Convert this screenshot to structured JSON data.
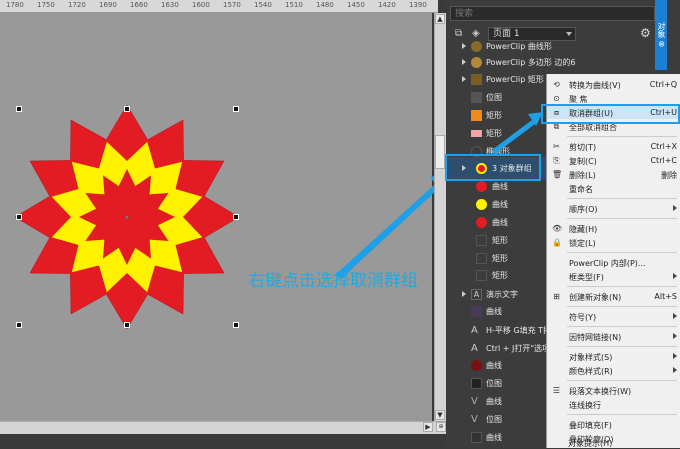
{
  "ruler": {
    "ticks": [
      "1780",
      "1750",
      "1720",
      "1690",
      "1660",
      "1630",
      "1600",
      "1570",
      "1540",
      "1510",
      "1480",
      "1450",
      "1420",
      "1390"
    ]
  },
  "annotation": {
    "text": "右键点击选择取消群组"
  },
  "colors": {
    "accent": "#21a9e1",
    "star_red": "#e31b23",
    "star_yellow": "#fff200"
  },
  "panel": {
    "search_placeholder": "搜索",
    "page_label": "页面 1",
    "docker_tab": "对象 ⊗",
    "objects": [
      {
        "label": "PowerClip 曲线形"
      },
      {
        "label": "PowerClip 多边形 边的6"
      },
      {
        "label": "PowerClip 矩形"
      },
      {
        "label": "位图"
      },
      {
        "label": "矩形"
      },
      {
        "label": "矩形"
      },
      {
        "label": "椭圆形"
      },
      {
        "label": "3 对象群组"
      },
      {
        "label": "曲线"
      },
      {
        "label": "曲线"
      },
      {
        "label": "曲线"
      },
      {
        "label": "矩形"
      },
      {
        "label": "矩形"
      },
      {
        "label": "矩形"
      },
      {
        "label": "演示文字"
      },
      {
        "label": "曲线"
      },
      {
        "label": "H-平移  G填充 T拷贝"
      },
      {
        "label": "Ctrl + J打开\"选项\""
      },
      {
        "label": "曲线"
      },
      {
        "label": "位图"
      },
      {
        "label": "曲线"
      },
      {
        "label": "位图"
      },
      {
        "label": "曲线"
      }
    ]
  },
  "menu": {
    "items": [
      {
        "label": "转换为曲线(V)",
        "shortcut": "Ctrl+Q"
      },
      {
        "label": "聚 焦",
        "shortcut": ""
      },
      {
        "label": "取消群组(U)",
        "shortcut": "Ctrl+U"
      },
      {
        "label": "全部取消组合",
        "shortcut": ""
      },
      {
        "label": "剪切(T)",
        "shortcut": "Ctrl+X"
      },
      {
        "label": "复制(C)",
        "shortcut": "Ctrl+C"
      },
      {
        "label": "删除(L)",
        "shortcut": "删除"
      },
      {
        "label": "重命名",
        "shortcut": ""
      },
      {
        "label": "顺序(O)",
        "shortcut": ""
      },
      {
        "label": "隐藏(H)",
        "shortcut": ""
      },
      {
        "label": "锁定(L)",
        "shortcut": ""
      },
      {
        "label": "PowerClip 内部(P)...",
        "shortcut": ""
      },
      {
        "label": "框类型(F)",
        "shortcut": ""
      },
      {
        "label": "创建新对象(N)",
        "shortcut": "Alt+S"
      },
      {
        "label": "符号(Y)",
        "shortcut": ""
      },
      {
        "label": "因特网链接(N)",
        "shortcut": ""
      },
      {
        "label": "对象样式(S)",
        "shortcut": ""
      },
      {
        "label": "颜色样式(R)",
        "shortcut": ""
      },
      {
        "label": "段落文本换行(W)",
        "shortcut": ""
      },
      {
        "label": "连线换行",
        "shortcut": ""
      },
      {
        "label": "叠印填充(F)",
        "shortcut": ""
      },
      {
        "label": "叠印轮廓(O)",
        "shortcut": ""
      },
      {
        "label": "对象提示(H)",
        "shortcut": ""
      }
    ]
  }
}
